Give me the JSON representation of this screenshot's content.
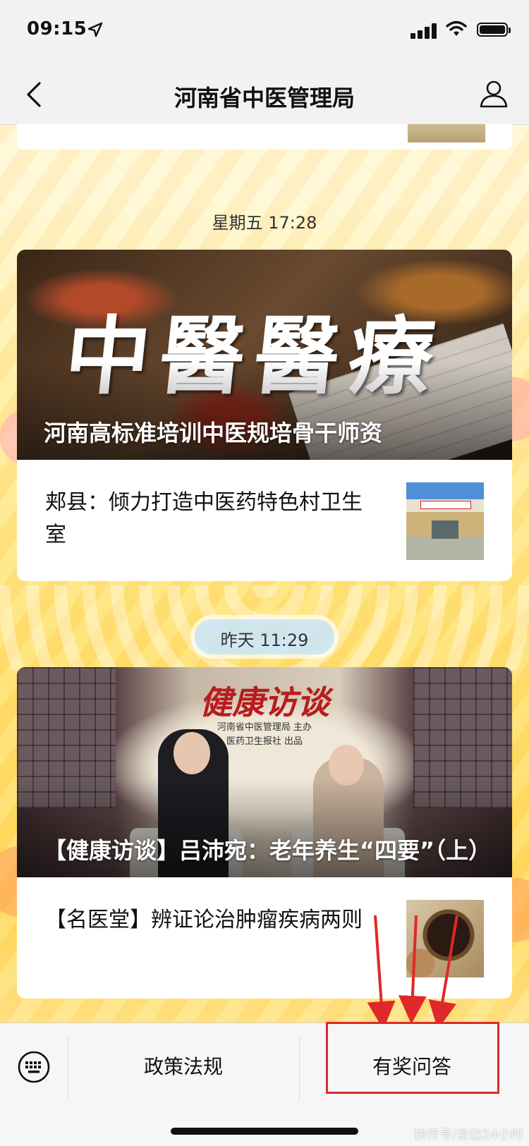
{
  "status_bar": {
    "time": "09:15"
  },
  "nav": {
    "title": "河南省中医管理局"
  },
  "feed": {
    "groups": [
      {
        "timestamp": "星期五 17:28",
        "hero": {
          "calligraphy": "中醫醫療",
          "title": "河南高标准培训中医规培骨干师资"
        },
        "items": [
          {
            "title": "郏县：倾力打造中医药特色村卫生室"
          }
        ]
      },
      {
        "timestamp": "昨天 11:29",
        "hero": {
          "show_title": "健康访谈",
          "show_sub_line1": "河南省中医管理局 主办",
          "show_sub_line2": "医药卫生报社 出品",
          "title": "【健康访谈】吕沛宛：老年养生“四要”（上）"
        },
        "items": [
          {
            "title": "【名医堂】辨证论治肿瘤疾病两则"
          }
        ]
      }
    ]
  },
  "menu": {
    "items": [
      {
        "label": "政策法规"
      },
      {
        "label": "有奖问答"
      }
    ]
  },
  "colors": {
    "highlight": "#e0282a",
    "arrow": "#e0282a"
  },
  "watermark": "快传号/身边24小时"
}
